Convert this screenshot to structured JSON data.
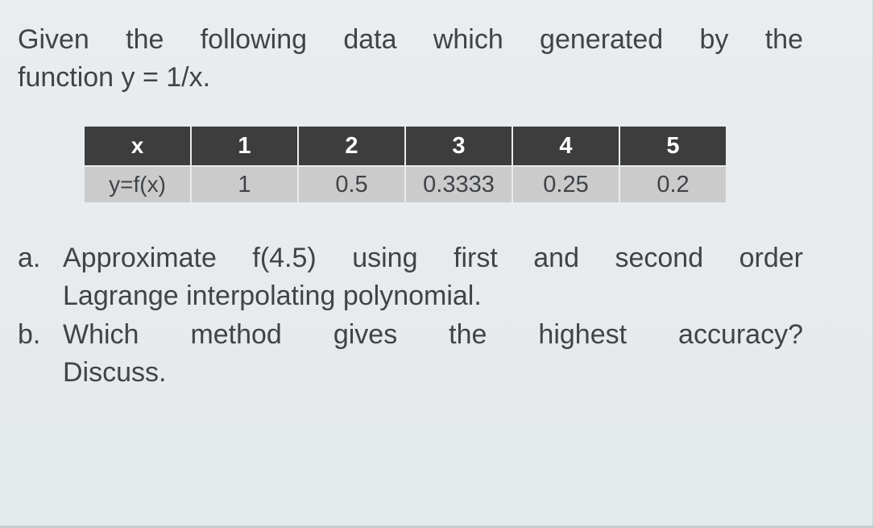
{
  "document": {
    "intro_line1": "Given the following data which generated by the",
    "intro_line2": "function y = 1/x."
  },
  "table": {
    "row_header_x": "x",
    "row_header_y": "y=f(x)",
    "x_values": [
      "1",
      "2",
      "3",
      "4",
      "5"
    ],
    "y_values": [
      "1",
      "0.5",
      "0.3333",
      "0.25",
      "0.2"
    ],
    "header_bg": "#3d3d3d",
    "header_color": "#ffffff",
    "body_bg": "#cbcbcb",
    "body_color": "#3f4347"
  },
  "questions": [
    {
      "marker": "a.",
      "line1": "Approximate f(4.5) using first and second order",
      "line2": "Lagrange interpolating polynomial."
    },
    {
      "marker": "b.",
      "line1": "Which method gives the highest accuracy?",
      "line2": "Discuss."
    }
  ],
  "chart_data": {
    "type": "table",
    "title": "Data generated by the function y = 1/x",
    "columns": [
      "x",
      "1",
      "2",
      "3",
      "4",
      "5"
    ],
    "rows": [
      [
        "y=f(x)",
        "1",
        "0.5",
        "0.3333",
        "0.25",
        "0.2"
      ]
    ],
    "x": [
      1,
      2,
      3,
      4,
      5
    ],
    "values": [
      1,
      0.5,
      0.3333,
      0.25,
      0.2
    ],
    "xlabel": "x",
    "ylabel": "y=f(x)"
  }
}
